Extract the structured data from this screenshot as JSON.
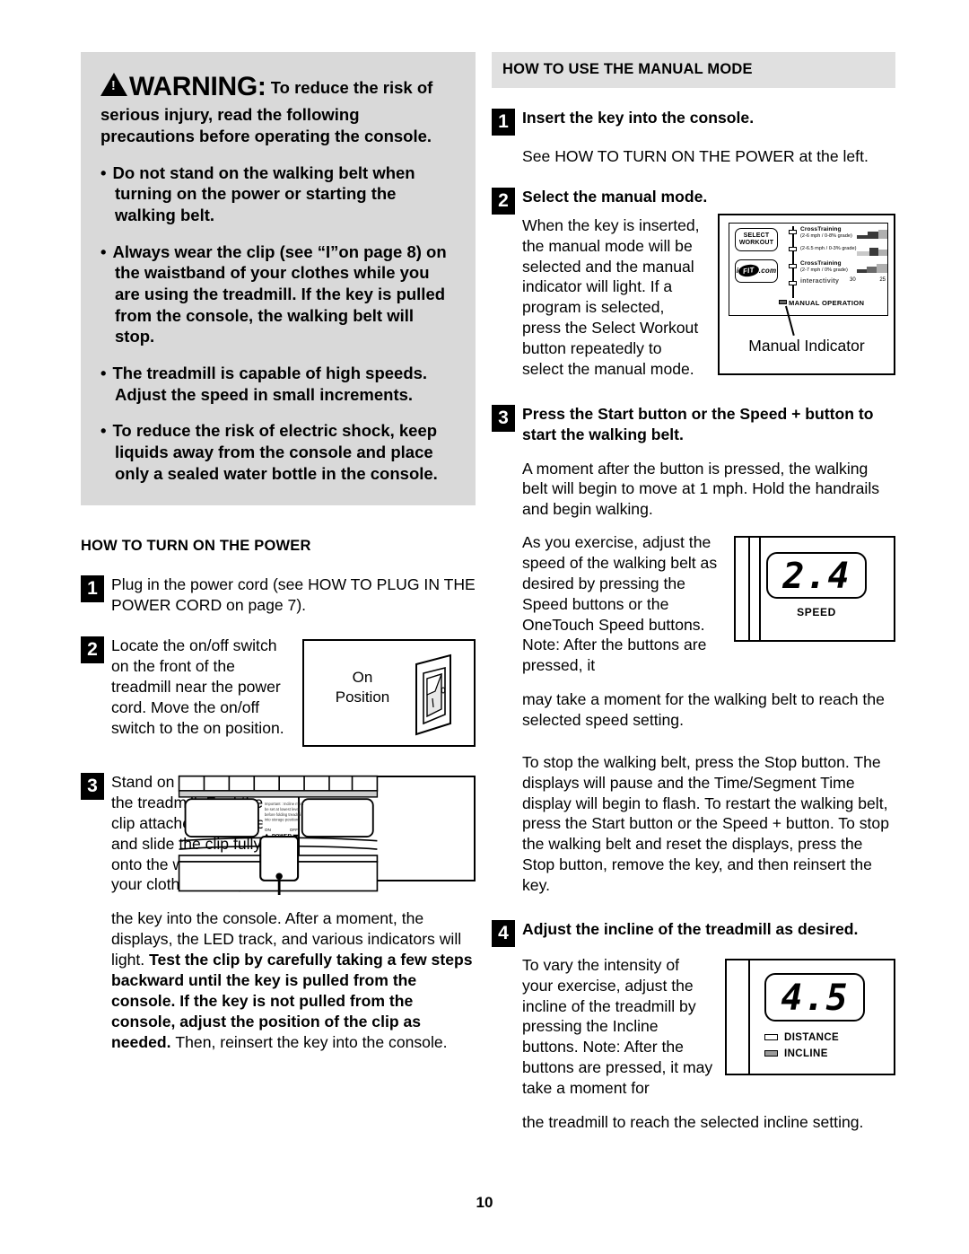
{
  "page": {
    "number": "10"
  },
  "warning": {
    "label": "WARNING",
    "colon": ":",
    "lead": "To reduce the risk of serious injury, read the following precautions before operating the console.",
    "bullets": [
      "Do not stand on the walking belt when turning on the power or starting the walking belt.",
      "Always wear the clip (see “I”on page 8) on the waistband of your clothes while you are using the treadmill. If the key is pulled from the console, the walking belt will stop.",
      "The treadmill is capable of high speeds. Adjust the speed in small increments.",
      "To reduce the risk of electric shock, keep liquids away from the console and place only a sealed water bottle in the console."
    ]
  },
  "left_section": {
    "heading": "HOW TO TURN ON THE POWER",
    "step1": {
      "num": "1",
      "text": "Plug in the power cord (see HOW TO PLUG IN THE POWER CORD on page 7)."
    },
    "step2": {
      "num": "2",
      "text": "Locate the on/off switch on the front of the treadmill near the power cord. Move the on/off switch to the on position.",
      "figure_label": "On Position"
    },
    "step3": {
      "num": "3",
      "text_before": "Stand on the foot rails of the treadmill. Find the clip attached to the key and slide the clip fully onto the waistband of your clothes. Next, insert",
      "text_cont_normal": "the key into the console. After a moment, the displays, the LED track, and various indicators will light. ",
      "text_cont_bold": "Test the clip by carefully taking a few steps backward until the key is pulled from the console. If the key is not pulled from the console, adjust the position of the clip as needed. ",
      "text_cont_end": "Then, reinsert the key into the console.",
      "figure": {
        "power_label": "POWER",
        "on_label": "ON",
        "off_label": "OFF",
        "notice": "Important : Incline must be set at lowest level before folding treadmill into storage position."
      }
    }
  },
  "right_section": {
    "heading": "HOW TO USE THE MANUAL MODE",
    "step1": {
      "num": "1",
      "title": "Insert the key into the console.",
      "body": "See HOW TO TURN ON THE POWER at the left."
    },
    "step2": {
      "num": "2",
      "title": "Select the manual mode.",
      "body": "When the key is inserted, the manual mode will be selected and the manual indicator will light. If a program is selected, press the Select Workout button repeatedly to select the manual mode.",
      "figure": {
        "caption": "Manual Indicator",
        "select_workout": "SELECT WORKOUT",
        "ifit_pre": "i",
        "ifit_oval": "FIT",
        "ifit_post": ".com",
        "manual_operation": "MANUAL OPERATION",
        "interactivity": "interactivity",
        "programs": [
          {
            "name": "CrossTraining",
            "detail": "(2-6 mph / 0-8% grade)"
          },
          {
            "name": "",
            "detail": "(2-6.5 mph / 0-3% grade)"
          },
          {
            "name": "CrossTraining",
            "detail": "(2-7 mph / 0% grade)"
          }
        ],
        "ticks": [
          "30",
          "25"
        ]
      }
    },
    "step3": {
      "num": "3",
      "title": "Press the Start button or the Speed + button to start the walking belt.",
      "body1": "A moment after the button is pressed, the walking belt will begin to move at 1 mph. Hold the handrails and begin walking.",
      "body2_narrow": "As you exercise, adjust the speed of the walking belt as desired by pressing the Speed buttons or the OneTouch Speed buttons. Note: After the buttons are pressed, it",
      "body2_cont": "may take a moment for the walking belt to reach the selected speed setting.",
      "body3": "To stop the walking belt, press the Stop button. The displays will pause and the Time/Segment Time display will begin to flash. To restart the walking belt, press the Start button or the Speed + button. To stop the walking belt and reset the displays, press the Stop button, remove the key, and then reinsert the key.",
      "figure": {
        "value": "2.4",
        "caption": "SPEED"
      }
    },
    "step4": {
      "num": "4",
      "title": "Adjust the incline of the treadmill as desired.",
      "body_narrow": "To vary the intensity of your exercise, adjust the incline of the treadmill by pressing the Incline buttons. Note: After the buttons are pressed, it may take a moment for",
      "body_cont": "the treadmill to reach the selected incline setting.",
      "figure": {
        "value": "4.5",
        "led_distance": "DISTANCE",
        "led_incline": "INCLINE"
      }
    }
  }
}
